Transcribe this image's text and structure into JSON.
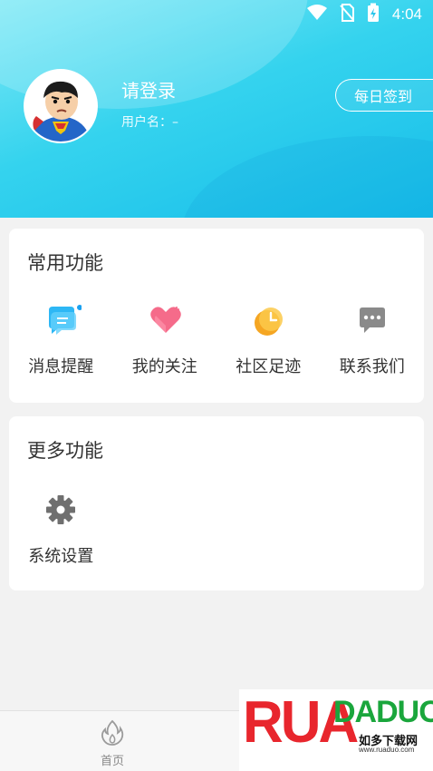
{
  "status_bar": {
    "time": "4:04",
    "icons": [
      "wifi-icon",
      "no-sim-icon",
      "battery-charging-icon"
    ]
  },
  "profile": {
    "login_prompt": "请登录",
    "username_label": "用户名：–",
    "checkin_label": "每日签到",
    "avatar": "superman-avatar"
  },
  "common": {
    "title": "常用功能",
    "items": [
      {
        "label": "消息提醒",
        "icon": "chat-bubble-icon",
        "color": "#2db7f5"
      },
      {
        "label": "我的关注",
        "icon": "heart-icon",
        "color": "#f56b8a"
      },
      {
        "label": "社区足迹",
        "icon": "clock-icon",
        "color": "#f5a623"
      },
      {
        "label": "联系我们",
        "icon": "message-icon",
        "color": "#8a8a8a"
      }
    ]
  },
  "more": {
    "title": "更多功能",
    "items": [
      {
        "label": "系统设置",
        "icon": "gear-icon",
        "color": "#6f6f6f"
      }
    ]
  },
  "bottom_nav": {
    "home_label": "首页",
    "home_icon": "flame-icon"
  },
  "watermark": {
    "logo": "RUAODADUO",
    "text_rua": "RUA",
    "text_duo": "DADUO",
    "cn": "如多下载网",
    "url": "www.ruaduo.com"
  }
}
